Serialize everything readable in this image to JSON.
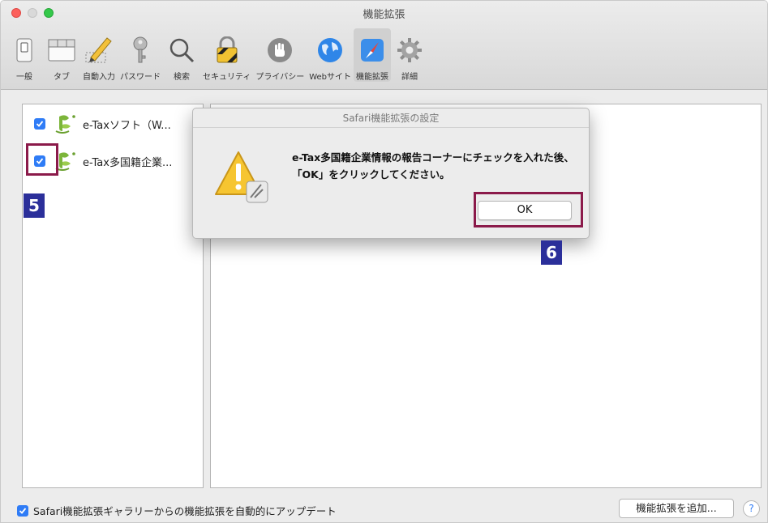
{
  "window": {
    "title": "機能拡張"
  },
  "toolbar": {
    "items": [
      {
        "label": "一般",
        "icon": "general-switch-icon"
      },
      {
        "label": "タブ",
        "icon": "tabs-icon"
      },
      {
        "label": "自動入力",
        "icon": "pencil-icon"
      },
      {
        "label": "パスワード",
        "icon": "key-icon"
      },
      {
        "label": "検索",
        "icon": "search-icon"
      },
      {
        "label": "セキュリティ",
        "icon": "lock-icon"
      },
      {
        "label": "プライバシー",
        "icon": "hand-icon"
      },
      {
        "label": "Webサイト",
        "icon": "globe-icon"
      },
      {
        "label": "機能拡張",
        "icon": "extensions-icon",
        "active": true
      },
      {
        "label": "詳細",
        "icon": "gear-icon"
      }
    ]
  },
  "extensions": [
    {
      "label": "e-Taxソフト（W...",
      "checked": true
    },
    {
      "label": "e-Tax多国籍企業...",
      "checked": true
    }
  ],
  "dialog": {
    "title": "Safari機能拡張の設定",
    "message": "e-Tax多国籍企業情報の報告コーナーにチェックを入れた後、「OK」をクリックしてください。",
    "ok_label": "OK"
  },
  "annotations": {
    "step5": "5",
    "step6": "6",
    "color": "#8b1a4a",
    "badge_color": "#2b2f9a"
  },
  "footer": {
    "auto_update_label": "Safari機能拡張ギャラリーからの機能拡張を自動的にアップデート",
    "auto_update_checked": true,
    "add_button_label": "機能拡張を追加...",
    "help_label": "?"
  },
  "colors": {
    "accent": "#2f7cf6"
  }
}
